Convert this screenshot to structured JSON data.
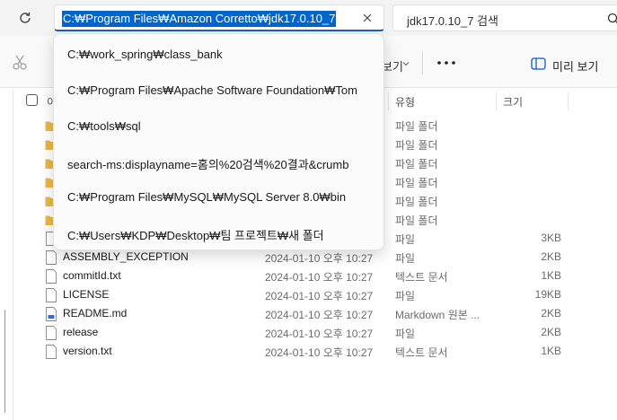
{
  "address_bar": {
    "value": "C:₩Program Files₩Amazon Corretto₩jdk17.0.10_7"
  },
  "search": {
    "value": "jdk17.0.10_7 검색"
  },
  "toolbar": {
    "view_label": "보기",
    "preview_label": "미리 보기"
  },
  "columns": {
    "name": "이",
    "type": "유형",
    "size": "크기"
  },
  "dropdown": {
    "items": [
      {
        "label": "C:₩work_spring₩class_bank"
      },
      {
        "label": "C:₩Program Files₩Apache Software Foundation₩Tom"
      },
      {
        "label": "C:₩tools₩sql"
      },
      {
        "label": "search-ms:displayname=홈의%20검색%20결과&crumb"
      },
      {
        "label": "C:₩Program Files₩MySQL₩MySQL Server 8.0₩bin"
      },
      {
        "label": "C:₩Users₩KDP₩Desktop₩팀 프로젝트₩새 폴더"
      }
    ]
  },
  "files": [
    {
      "kind": "folder",
      "name": "",
      "date": "",
      "type": "파일 폴더",
      "size": ""
    },
    {
      "kind": "folder",
      "name": "",
      "date": "",
      "type": "파일 폴더",
      "size": ""
    },
    {
      "kind": "folder",
      "name": "",
      "date": "",
      "type": "파일 폴더",
      "size": ""
    },
    {
      "kind": "folder",
      "name": "",
      "date": "",
      "type": "파일 폴더",
      "size": ""
    },
    {
      "kind": "folder",
      "name": "",
      "date": "",
      "type": "파일 폴더",
      "size": ""
    },
    {
      "kind": "folder",
      "name": "",
      "date": "",
      "type": "파일 폴더",
      "size": ""
    },
    {
      "kind": "file",
      "name": "",
      "date": "",
      "type": "파일",
      "size": "3KB"
    },
    {
      "kind": "file",
      "name": "ASSEMBLY_EXCEPTION",
      "date": "2024-01-10 오후 10:27",
      "type": "파일",
      "size": "2KB"
    },
    {
      "kind": "file",
      "name": "commitId.txt",
      "date": "2024-01-10 오후 10:27",
      "type": "텍스트 문서",
      "size": "1KB"
    },
    {
      "kind": "file",
      "name": "LICENSE",
      "date": "2024-01-10 오후 10:27",
      "type": "파일",
      "size": "19KB"
    },
    {
      "kind": "md",
      "name": "README.md",
      "date": "2024-01-10 오후 10:27",
      "type": "Markdown 원본 ...",
      "size": "2KB"
    },
    {
      "kind": "file",
      "name": "release",
      "date": "2024-01-10 오후 10:27",
      "type": "파일",
      "size": "2KB"
    },
    {
      "kind": "file",
      "name": "version.txt",
      "date": "2024-01-10 오후 10:27",
      "type": "텍스트 문서",
      "size": "1KB"
    }
  ],
  "colors": {
    "accent": "#0066cc",
    "folder": "#e8b84a"
  },
  "icons": {
    "refresh": "refresh-icon",
    "clear": "close-icon",
    "search": "search-icon",
    "cut": "scissors-icon",
    "more": "more-icon",
    "preview": "preview-pane-icon",
    "folder": "folder-icon",
    "file": "file-icon"
  }
}
